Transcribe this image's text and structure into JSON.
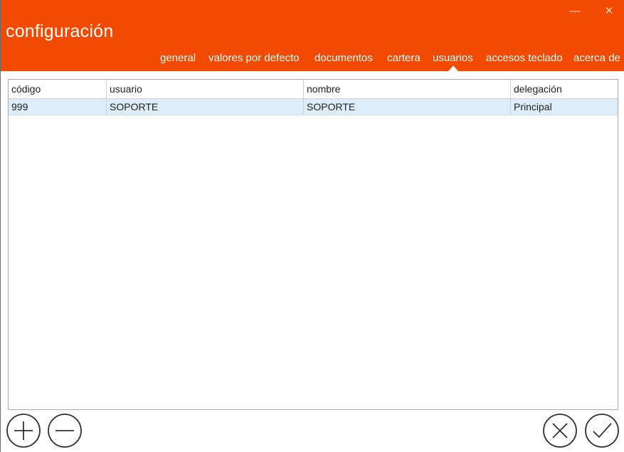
{
  "window": {
    "title": "configuración",
    "minimize_glyph": "—",
    "close_glyph": "✕"
  },
  "tabs": [
    {
      "label": "general"
    },
    {
      "label": "valores por defecto"
    },
    {
      "label": "documentos"
    },
    {
      "label": "cartera"
    },
    {
      "label": "usuarios",
      "selected": true
    },
    {
      "label": "accesos teclado"
    },
    {
      "label": "acerca de"
    }
  ],
  "grid": {
    "columns": [
      "código",
      "usuario",
      "nombre",
      "delegación"
    ],
    "rows": [
      [
        "999",
        "SOPORTE",
        "SOPORTE",
        "Principal"
      ]
    ],
    "selected_row": 0
  },
  "actions": {
    "add_icon": "plus-icon",
    "remove_icon": "minus-icon",
    "cancel_icon": "close-icon",
    "accept_icon": "check-icon"
  },
  "colors": {
    "accent": "#f24a00",
    "selected_row": "#ddeefa",
    "icon_stroke": "#333333"
  }
}
